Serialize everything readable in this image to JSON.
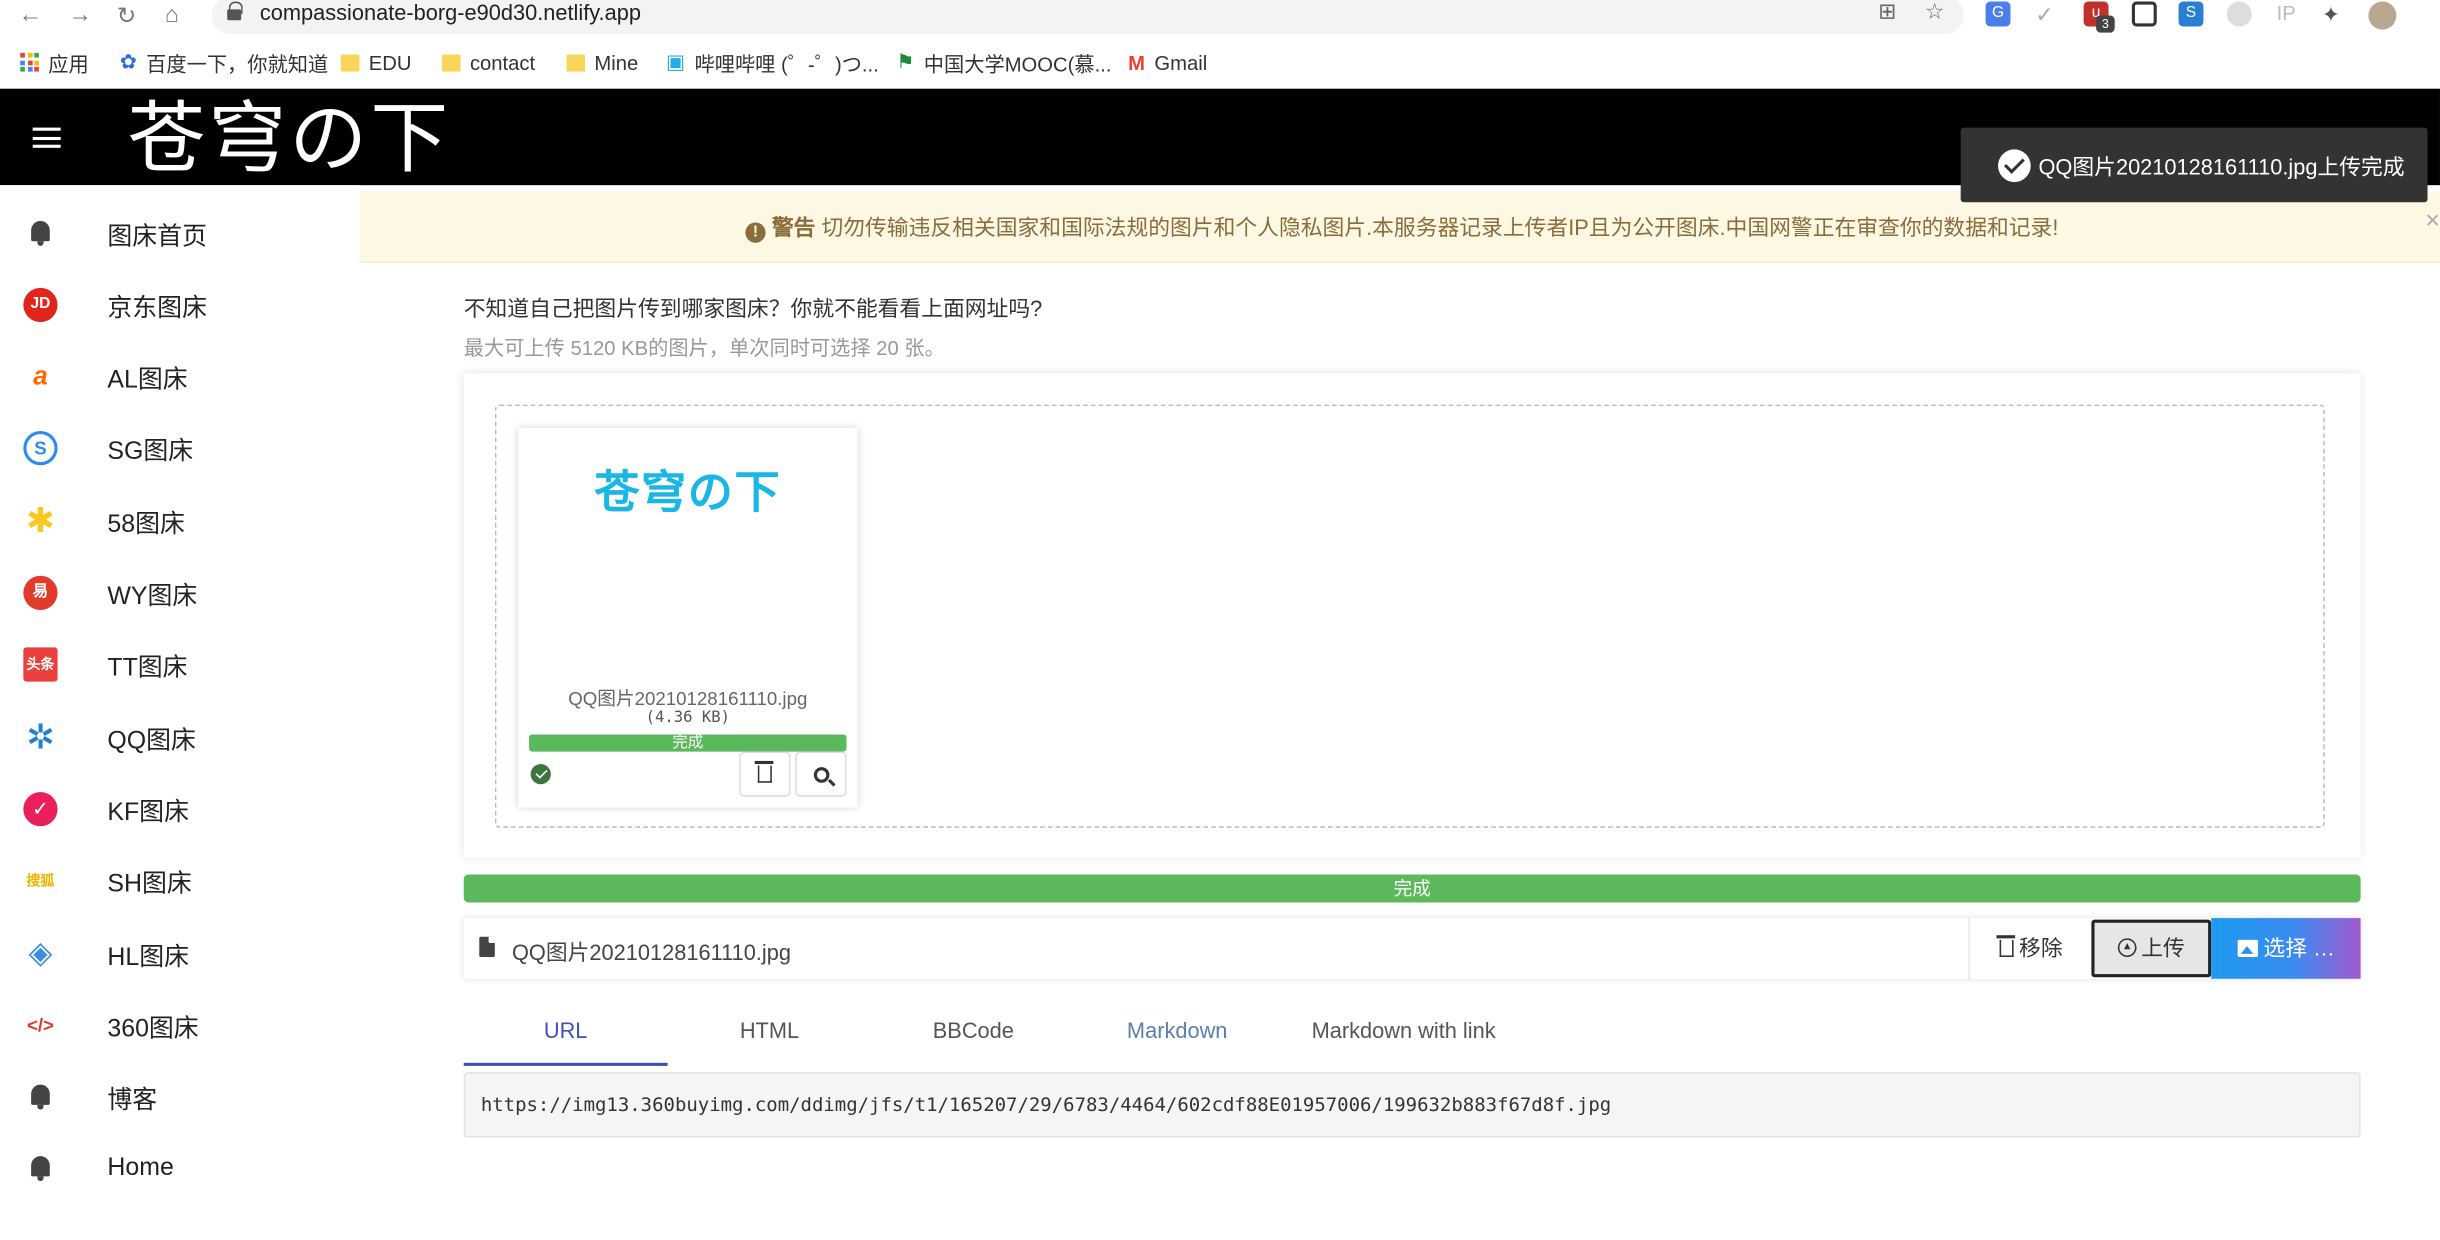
{
  "browser": {
    "url": "compassionate-borg-e90d30.netlify.app",
    "ext_badge": "3",
    "ext_ip": "IP",
    "bookmarks": [
      {
        "label": "应用"
      },
      {
        "label": "百度一下，你就知道"
      },
      {
        "label": "EDU"
      },
      {
        "label": "contact"
      },
      {
        "label": "Mine"
      },
      {
        "label": "哔哩哔哩 (゜-゜)つ..."
      },
      {
        "label": "中国大学MOOC(慕..."
      },
      {
        "label": "Gmail"
      }
    ]
  },
  "header": {
    "logo": "苍穹の下"
  },
  "sidebar": {
    "items": [
      {
        "label": "图床首页",
        "icon": "bell-icon"
      },
      {
        "label": "京东图床",
        "icon": "jd-icon",
        "color": "#e1251b",
        "glyph": "JD"
      },
      {
        "label": "AL图床",
        "icon": "alibaba-icon",
        "color": "#ff6a00",
        "glyph": "a"
      },
      {
        "label": "SG图床",
        "icon": "sogou-icon",
        "color": "#2d8cf0",
        "glyph": "S"
      },
      {
        "label": "58图床",
        "icon": "58-icon",
        "color": "#f7c81e",
        "glyph": "✱"
      },
      {
        "label": "WY图床",
        "icon": "netease-icon",
        "color": "#e03b2b",
        "glyph": "易"
      },
      {
        "label": "TT图床",
        "icon": "toutiao-icon",
        "color": "#e8413b",
        "glyph": "头条"
      },
      {
        "label": "QQ图床",
        "icon": "qq-icon",
        "color": "#1f7fd6",
        "glyph": "✲"
      },
      {
        "label": "KF图床",
        "icon": "kf-icon",
        "color": "#e9205d",
        "glyph": "✓"
      },
      {
        "label": "SH图床",
        "icon": "sohu-icon",
        "color": "#f2b400",
        "glyph": "搜狐"
      },
      {
        "label": "HL图床",
        "icon": "hl-icon",
        "color": "#3b8de0",
        "glyph": "◈"
      },
      {
        "label": "360图床",
        "icon": "code-icon",
        "color": "#e0382a",
        "glyph": "</>"
      },
      {
        "label": "博客",
        "icon": "bell-icon"
      },
      {
        "label": "Home",
        "icon": "bell-icon"
      }
    ]
  },
  "warning": {
    "title": "警告",
    "text": "切勿传输违反相关国家和国际法规的图片和个人隐私图片.本服务器记录上传者IP且为公开图床.中国网警正在审查你的数据和记录!",
    "close": "×"
  },
  "toast": {
    "text": "QQ图片20210128161110.jpg上传完成"
  },
  "main": {
    "intro": "不知道自己把图片传到哪家图床？你就不能看看上面网址吗?",
    "limit": "最大可上传 5120 KB的图片，单次同时可选择 20 张。",
    "thumb": {
      "preview_text": "苍穹の下",
      "filename": "QQ图片20210128161110.jpg",
      "size": "(4.36 KB)",
      "status": "完成",
      "progress": 1.0
    },
    "progress_label": "完成",
    "progress": 1.0,
    "file": {
      "name": "QQ图片20210128161110.jpg",
      "remove_label": "移除",
      "upload_label": "上传",
      "select_label": "选择 …"
    },
    "tabs": [
      {
        "label": "URL",
        "active": true
      },
      {
        "label": "HTML"
      },
      {
        "label": "BBCode"
      },
      {
        "label": "Markdown"
      },
      {
        "label": "Markdown with link"
      }
    ],
    "output_url": "https://img13.360buyimg.com/ddimg/jfs/t1/165207/29/6783/4464/602cdf88E01957006/199632b883f67d8f.jpg"
  }
}
